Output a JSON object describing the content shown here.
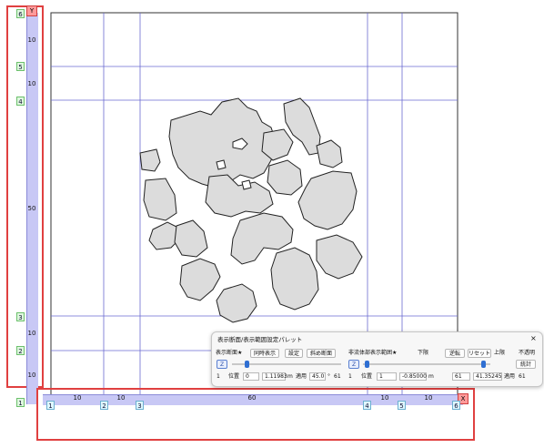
{
  "y_axis": {
    "axis_label": "Y",
    "nodes": [
      "6",
      "5",
      "4",
      "3",
      "2",
      "1"
    ],
    "spans": [
      "10",
      "10",
      "50",
      "10",
      "10"
    ]
  },
  "x_axis": {
    "axis_label": "X",
    "nodes": [
      "1",
      "2",
      "3",
      "4",
      "5",
      "6"
    ],
    "spans": [
      "10",
      "10",
      "60",
      "10",
      "10"
    ]
  },
  "palette": {
    "title": "表示断面/表示範囲設定パレット",
    "close_label": "×",
    "display_section": {
      "label": "表示断面★",
      "simultaneous_label": "同時表示",
      "settings_label": "設定",
      "oblique_label": "斜め断面",
      "axis_label": "Z",
      "index": "1",
      "position_label": "位置",
      "position_value": "0",
      "value": "1.11983",
      "unit": "m",
      "apply_label": "適用",
      "apply_value": "45.0",
      "degree_sign": "°",
      "count": "61"
    },
    "nonfluid_section": {
      "label": "非流体部表示範囲★",
      "lower_label": "下限",
      "reverse_label": "逆転",
      "reset_label": "リセット",
      "upper_label": "上限",
      "opacity_label": "不透明",
      "stats_label": "統計",
      "axis_label": "Z",
      "index": "1",
      "position_label": "位置",
      "position_value": "1",
      "lower_value": "-0.85000",
      "unit": "m",
      "upper_position": "61",
      "upper_value": "41.35245",
      "apply_label": "適用",
      "apply_value": "61"
    }
  },
  "colors": {
    "grid": "#6a6ad0",
    "region_fill": "#dcdcdc",
    "region_stroke": "#222222",
    "highlight_frame": "#e04040",
    "axis_bar": "#c8c8f5"
  }
}
